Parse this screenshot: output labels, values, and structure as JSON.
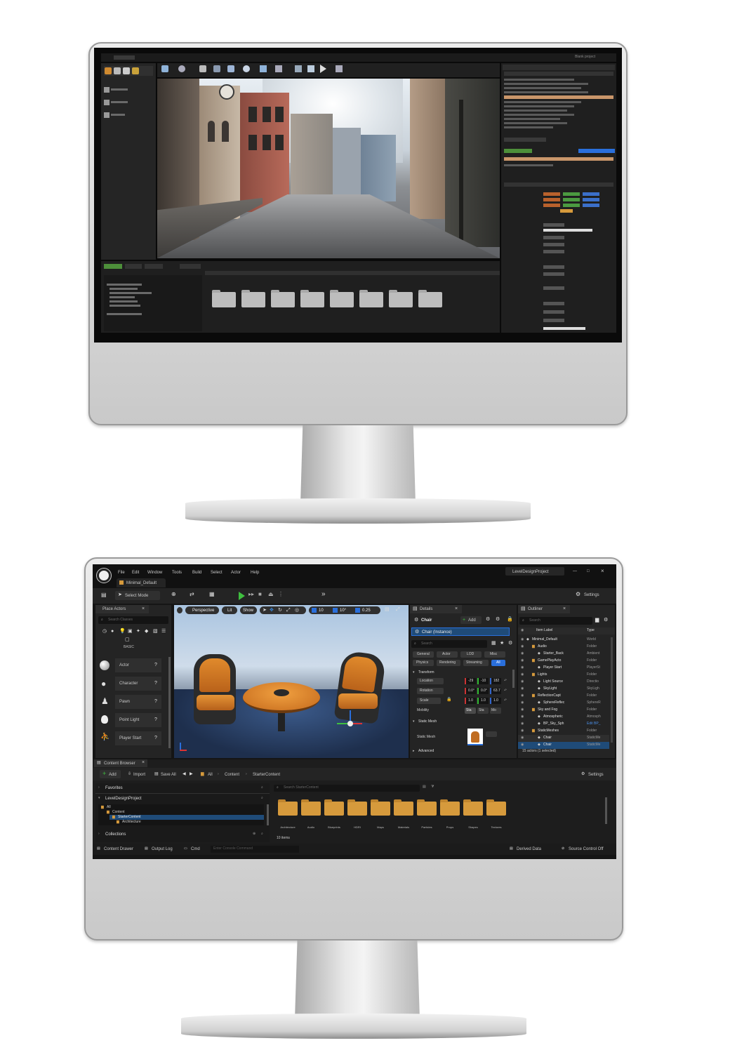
{
  "top_editor": {
    "title_text": "Blank project"
  },
  "editor": {
    "menu": [
      "File",
      "Edit",
      "Window",
      "Tools",
      "Build",
      "Select",
      "Actor",
      "Help"
    ],
    "project_name": "LevelDesignProject",
    "level_tab": "Minimal_Default",
    "select_mode": "Select Mode",
    "settings": "Settings",
    "place_actors": {
      "title": "Place Actors",
      "search_placeholder": "Search Classes",
      "category": "BASIC",
      "items": [
        "Actor",
        "Character",
        "Pawn",
        "Point Light",
        "Player Start"
      ]
    },
    "viewport": {
      "perspective": "Perspective",
      "lit": "Lit",
      "show": "Show",
      "snap_values": [
        "10",
        "10°",
        "0.25"
      ]
    },
    "details": {
      "title": "Details",
      "object": "Chair",
      "add": "Add",
      "instance": "Chair (Instance)",
      "search_placeholder": "Search",
      "filters_row1": [
        "General",
        "Actor",
        "LOD",
        "Misc"
      ],
      "filters_row2": [
        "Physics",
        "Rendering",
        "Streaming",
        "All"
      ],
      "transform": "Transform",
      "location": "Location",
      "rotation": "Rotation",
      "scale": "Scale",
      "mobility": "Mobility",
      "mobility_options": [
        "Sta",
        "Sta",
        "Mo"
      ],
      "location_values": [
        "-29",
        "-10",
        "182"
      ],
      "rotation_values": [
        "0.0°",
        "0.0°",
        "63.7"
      ],
      "scale_values": [
        "1.0",
        "1.0",
        "1.0"
      ],
      "static_mesh_section": "Static Mesh",
      "static_mesh_label": "Static Mesh",
      "advanced": "Advanced"
    },
    "outliner": {
      "title": "Outliner",
      "search_placeholder": "Search",
      "col_label": "Item Label",
      "col_type": "Type",
      "rows": [
        {
          "label": "Minimal_Default",
          "type": "World"
        },
        {
          "label": "Audio",
          "type": "Folder"
        },
        {
          "label": "Starter_Back",
          "type": "Ambient"
        },
        {
          "label": "GamePlayActo",
          "type": "Folder"
        },
        {
          "label": "Player Start",
          "type": "PlayerSt"
        },
        {
          "label": "Lights",
          "type": "Folder"
        },
        {
          "label": "Light Source",
          "type": "Directio"
        },
        {
          "label": "SkyLight",
          "type": "SkyLigh"
        },
        {
          "label": "ReflectionCapt",
          "type": "Folder"
        },
        {
          "label": "SphereReflec",
          "type": "SphereR"
        },
        {
          "label": "Sky and Fog",
          "type": "Folder"
        },
        {
          "label": "Atmospheric",
          "type": "Atmosph"
        },
        {
          "label": "BP_Sky_Sph",
          "type": "Edit BP_"
        },
        {
          "label": "StaticMeshes",
          "type": "Folder"
        },
        {
          "label": "Chair",
          "type": "StaticMe"
        },
        {
          "label": "Chair",
          "type": "StaticMe"
        }
      ],
      "footer": "15 actors (1 selected)"
    },
    "content_browser": {
      "title": "Content Browser",
      "add": "Add",
      "import": "Import",
      "save_all": "Save All",
      "path": [
        "All",
        "Content",
        "StarterContent"
      ],
      "settings": "Settings",
      "favorites": "Favorites",
      "project": "LevelDesignProject",
      "tree": [
        "All",
        "Content",
        "StarterContent",
        "Architecture"
      ],
      "collections": "Collections",
      "search_placeholder": "Search StarterContent",
      "folders": [
        "Architecture",
        "Audio",
        "Blueprints",
        "HDRI",
        "Maps",
        "Materials",
        "Particles",
        "Props",
        "Shapes",
        "Textures"
      ],
      "count": "10 items"
    },
    "status_bar": {
      "content_drawer": "Content Drawer",
      "output_log": "Output Log",
      "cmd": "Cmd",
      "console_placeholder": "Enter Console Command",
      "derived_data": "Derived Data",
      "source_control": "Source Control Off"
    }
  },
  "colors": {
    "accent_orange": "#d69a3c",
    "accent_blue": "#2a6fdb",
    "play_green": "#3fbf3f",
    "panel": "#242424",
    "bg": "#151515"
  }
}
